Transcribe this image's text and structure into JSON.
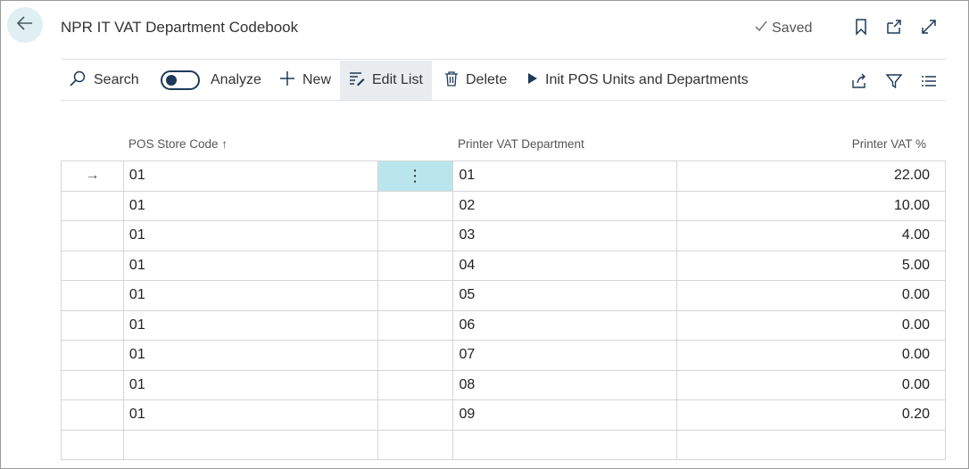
{
  "header": {
    "title": "NPR IT VAT Department Codebook",
    "saved_label": "Saved"
  },
  "toolbar": {
    "search_label": "Search",
    "analyze_label": "Analyze",
    "new_label": "New",
    "edit_list_label": "Edit List",
    "delete_label": "Delete",
    "init_label": "Init POS Units and Departments"
  },
  "table": {
    "columns": {
      "store_code": "POS Store Code ↑",
      "vat_department": "Printer VAT Department",
      "vat_pct": "Printer VAT %"
    },
    "rows": [
      {
        "store_code": "01",
        "vat_department": "01",
        "vat_pct": "22.00"
      },
      {
        "store_code": "01",
        "vat_department": "02",
        "vat_pct": "10.00"
      },
      {
        "store_code": "01",
        "vat_department": "03",
        "vat_pct": "4.00"
      },
      {
        "store_code": "01",
        "vat_department": "04",
        "vat_pct": "5.00"
      },
      {
        "store_code": "01",
        "vat_department": "05",
        "vat_pct": "0.00"
      },
      {
        "store_code": "01",
        "vat_department": "06",
        "vat_pct": "0.00"
      },
      {
        "store_code": "01",
        "vat_department": "07",
        "vat_pct": "0.00"
      },
      {
        "store_code": "01",
        "vat_department": "08",
        "vat_pct": "0.00"
      },
      {
        "store_code": "01",
        "vat_department": "09",
        "vat_pct": "0.20"
      },
      {
        "store_code": "",
        "vat_department": "",
        "vat_pct": ""
      }
    ],
    "current_row_indicator": "→",
    "row_menu_glyph": "⋮"
  },
  "icons": {
    "back": "back-arrow-icon",
    "saved_check": "checkmark-icon",
    "bookmark": "bookmark-icon",
    "open_new_window": "open-in-new-window-icon",
    "expand": "expand-icon",
    "search": "search-icon",
    "new": "plus-icon",
    "edit_list": "edit-list-icon",
    "delete": "trash-icon",
    "init": "play-icon",
    "share": "share-icon",
    "filter": "filter-icon",
    "list_view": "list-view-icon"
  },
  "colors": {
    "accent": "#1d3a5a",
    "back_bg": "#dfeff2",
    "selected_cell": "#b9e6ec",
    "active_toolbar_bg": "#e9edf0"
  }
}
